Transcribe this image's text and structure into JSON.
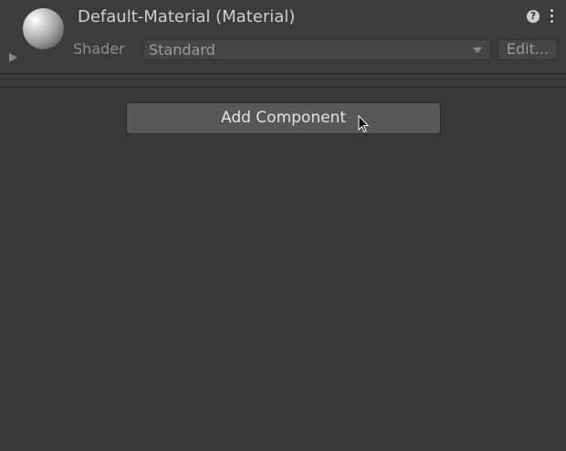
{
  "material": {
    "title": "Default-Material (Material)",
    "shader_label": "Shader",
    "shader_value": "Standard",
    "edit_label": "Edit...",
    "help_glyph": "?"
  },
  "inspector": {
    "add_component_label": "Add Component"
  },
  "icons": {
    "preview": "material-sphere-icon",
    "foldout": "foldout-arrow-icon",
    "help": "help-icon",
    "menu": "kebab-menu-icon",
    "dropdown": "chevron-down-icon",
    "cursor": "mouse-cursor-icon"
  },
  "colors": {
    "background": "#383838",
    "header": "#3c3c3c",
    "button": "#585858",
    "text": "#cfcfcf"
  }
}
